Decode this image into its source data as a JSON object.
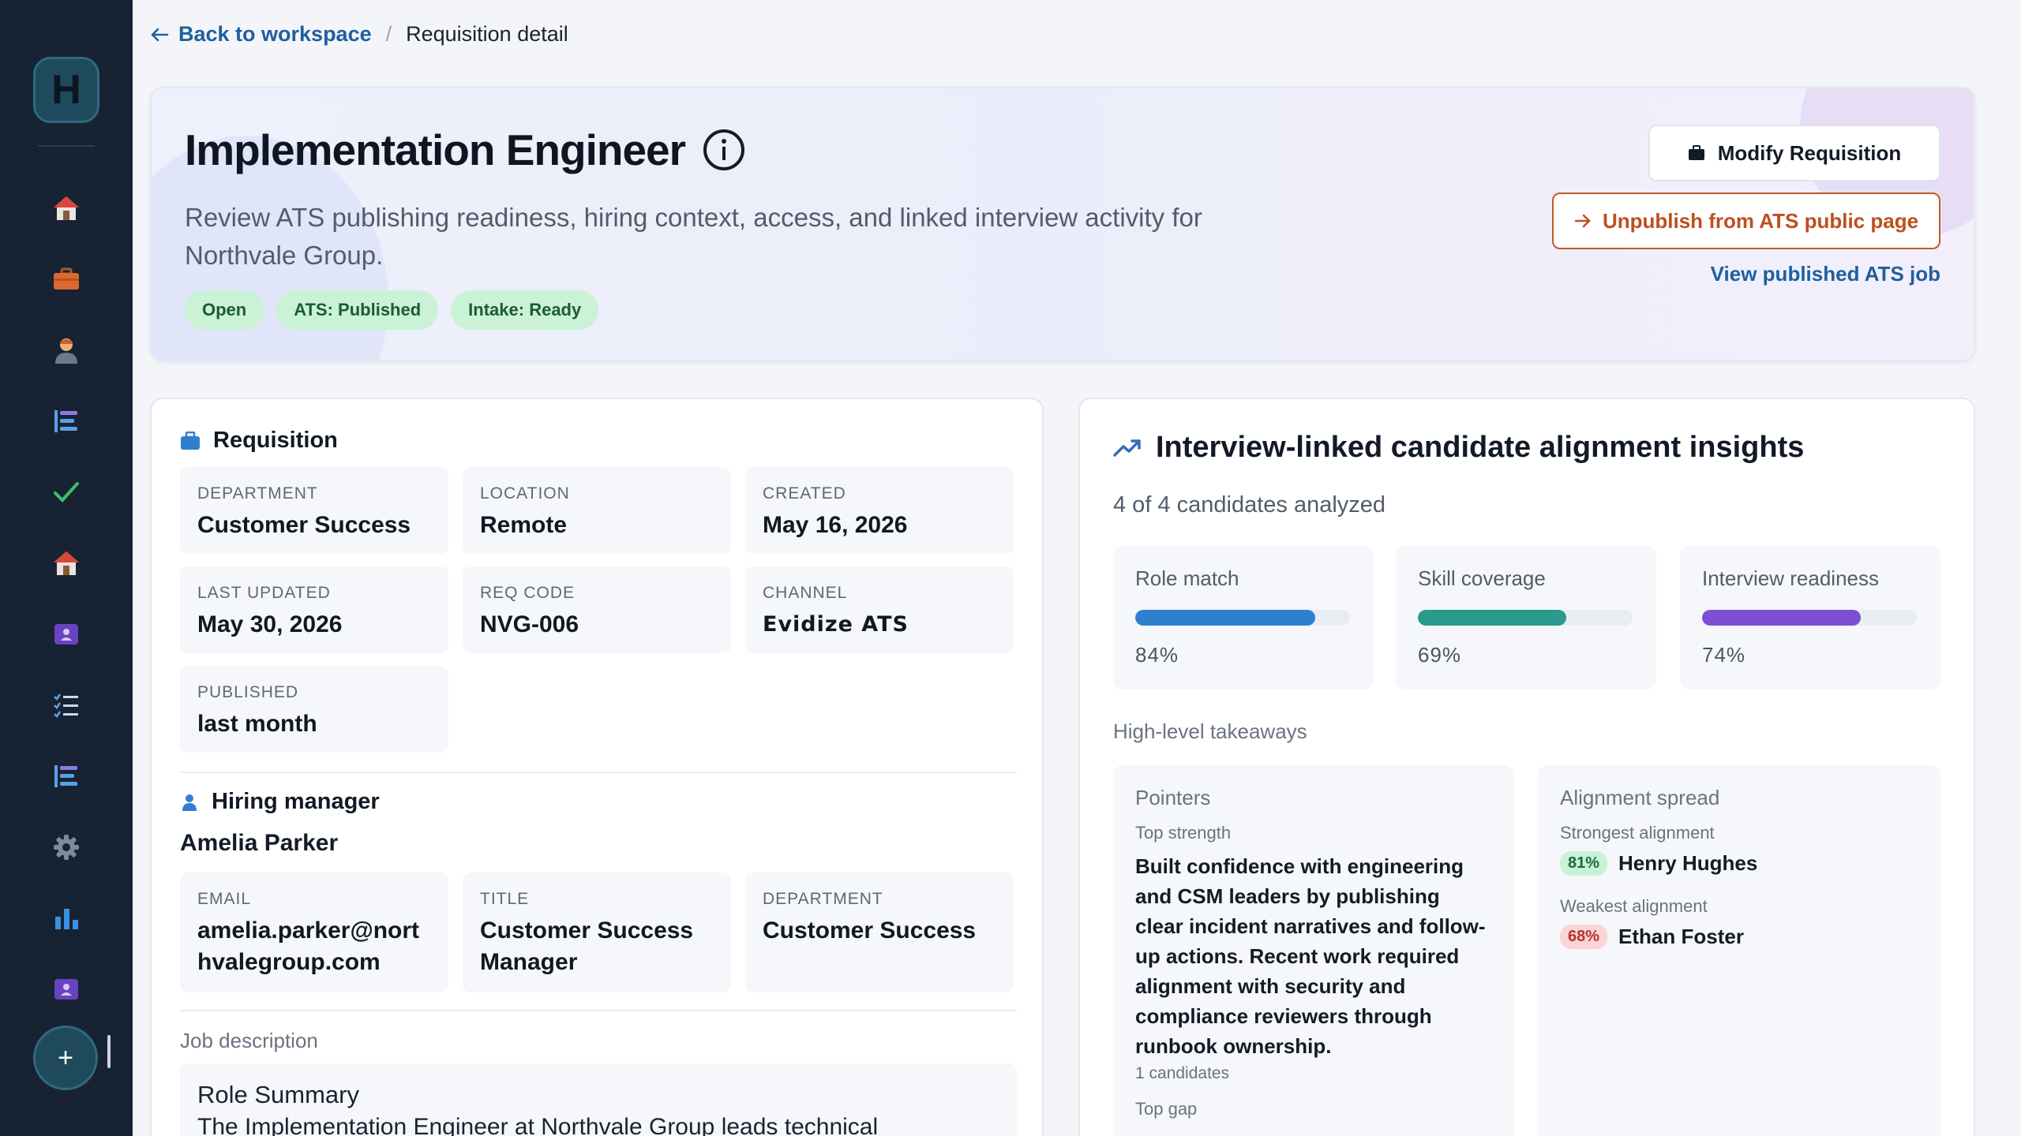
{
  "sidebar": {
    "logo": "H",
    "icons": [
      "home-icon",
      "briefcase-icon",
      "person-icon",
      "list-icon",
      "check-icon",
      "home-icon",
      "contact-card-icon",
      "checklist-icon",
      "list-icon",
      "gear-icon",
      "bar-chart-icon",
      "contact-card-icon"
    ],
    "fab": "+"
  },
  "breadcrumb": {
    "back_label": "Back to workspace",
    "separator": "/",
    "current": "Requisition detail"
  },
  "hero": {
    "title": "Implementation Engineer",
    "subtitle": "Review ATS publishing readiness, hiring context, access, and linked interview activity for Northvale Group.",
    "badges": [
      "Open",
      "ATS: Published",
      "Intake: Ready"
    ],
    "modify_button": "Modify Requisition",
    "unpublish_button": "Unpublish from ATS public page",
    "view_link": "View published ATS job"
  },
  "requisition": {
    "heading": "Requisition",
    "fields": [
      {
        "label": "Department",
        "value": "Customer Success"
      },
      {
        "label": "Location",
        "value": "Remote"
      },
      {
        "label": "Created",
        "value": "May 16, 2026"
      },
      {
        "label": "Last updated",
        "value": "May 30, 2026"
      },
      {
        "label": "Req code",
        "value": "NVG-006"
      },
      {
        "label": "Channel",
        "value": "Evidize ATS"
      },
      {
        "label": "Published",
        "value": "last month"
      }
    ]
  },
  "hiring_manager": {
    "heading": "Hiring manager",
    "name": "Amelia Parker",
    "fields": [
      {
        "label": "Email",
        "value": "amelia.parker@northvalegroup.com"
      },
      {
        "label": "Title",
        "value": "Customer Success Manager"
      },
      {
        "label": "Department",
        "value": "Customer Success"
      }
    ]
  },
  "job_description": {
    "label": "Job description",
    "heading": "Role Summary",
    "text": "The Implementation Engineer at Northvale Group leads technical"
  },
  "insights": {
    "title": "Interview-linked candidate alignment insights",
    "analyzed": "4 of 4 candidates analyzed",
    "metrics": [
      {
        "label": "Role match",
        "value": 84,
        "display": "84%",
        "color": "#2f7fd0"
      },
      {
        "label": "Skill coverage",
        "value": 69,
        "display": "69%",
        "color": "#2a9a8c"
      },
      {
        "label": "Interview readiness",
        "value": 74,
        "display": "74%",
        "color": "#7a4fd6"
      }
    ],
    "takeaways_label": "High-level takeaways",
    "pointers": {
      "title": "Pointers",
      "top_strength_label": "Top strength",
      "top_strength_text": "Built confidence with engineering and CSM leaders by publishing clear incident narratives and follow-up actions. Recent work required alignment with security and compliance reviewers through runbook ownership.",
      "top_strength_count": "1 candidates",
      "top_gap_label": "Top gap"
    },
    "spread": {
      "title": "Alignment spread",
      "strongest_label": "Strongest alignment",
      "strongest_pct": "81%",
      "strongest_name": "Henry Hughes",
      "weakest_label": "Weakest alignment",
      "weakest_pct": "68%",
      "weakest_name": "Ethan Foster"
    }
  }
}
